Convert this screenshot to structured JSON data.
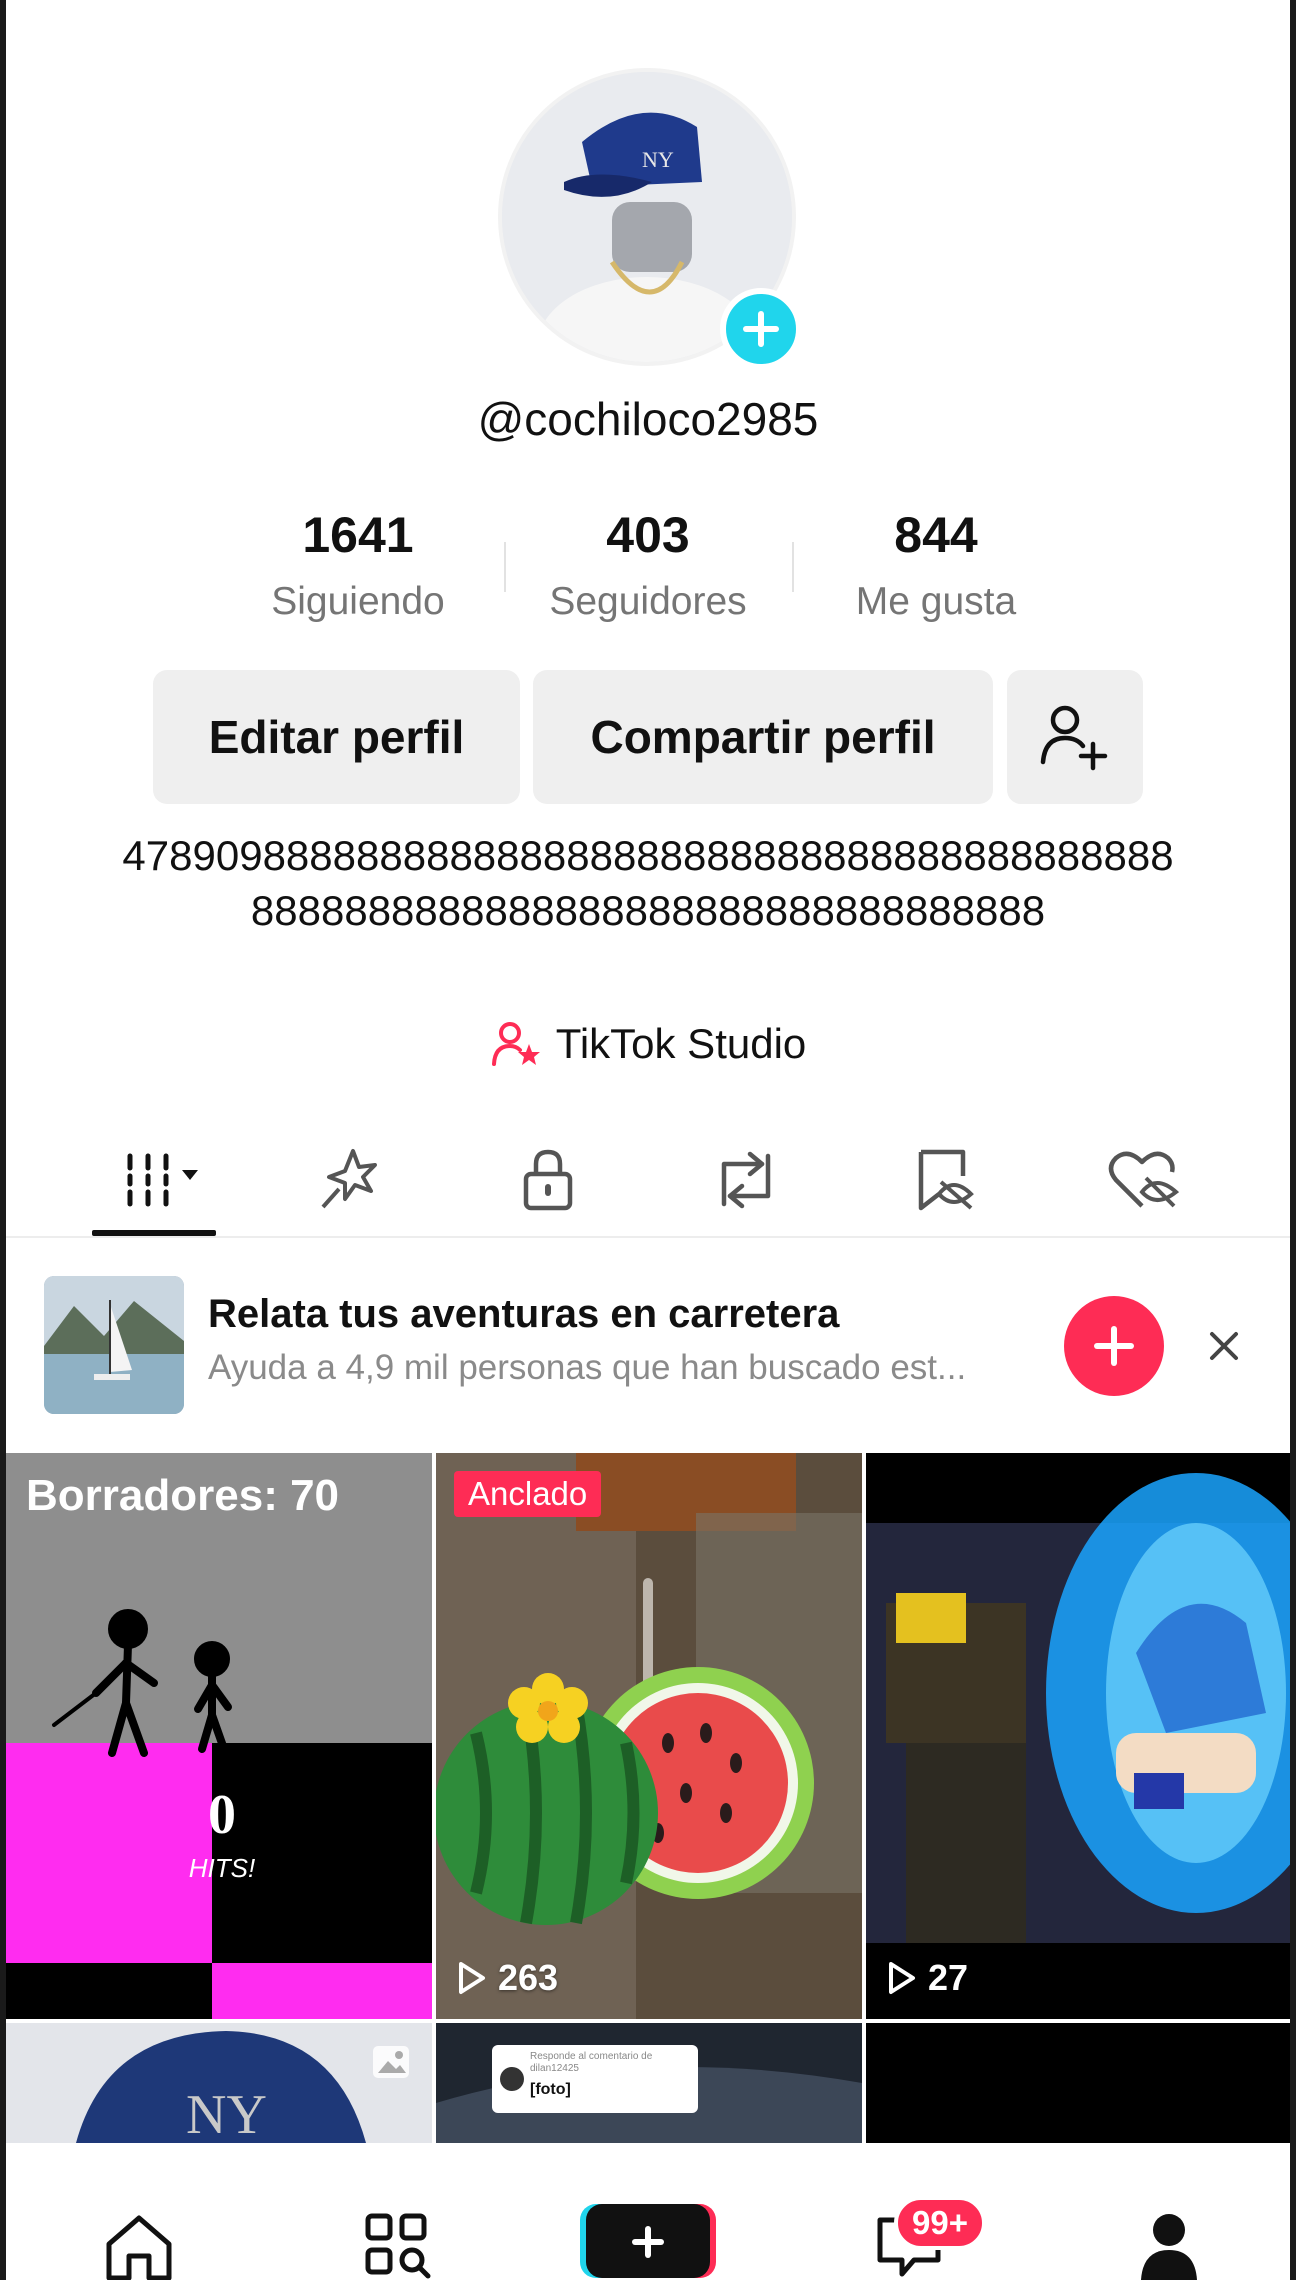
{
  "profile": {
    "username": "@cochiloco2985",
    "stats": [
      {
        "value": "1641",
        "label": "Siguiendo"
      },
      {
        "value": "403",
        "label": "Seguidores"
      },
      {
        "value": "844",
        "label": "Me gusta"
      }
    ],
    "edit_label": "Editar perfil",
    "share_label": "Compartir perfil",
    "bio": "4789098888888888888888888888888888888888888888888888888888888888888888888888888",
    "studio_label": "TikTok Studio"
  },
  "tabs": [
    "videos-tab-icon",
    "reposts-sparkle-icon",
    "private-lock-icon",
    "repost-icon",
    "favorites-icon",
    "liked-heart-icon"
  ],
  "promo": {
    "title": "Relata tus aventuras en carretera",
    "subtitle": "Ayuda a 4,9 mil personas que han buscado est..."
  },
  "grid": {
    "drafts_label": "Borradores: 70",
    "hits_number": "0",
    "hits_label": "HITS!",
    "pinned_label": "Anclado",
    "video2_views": "263",
    "video3_views": "27",
    "reply_title": "Responde al comentario de",
    "reply_user": "dilan12425",
    "reply_text": "[foto]"
  },
  "nav": {
    "badge": "99+"
  },
  "colors": {
    "accent": "#fe2c55",
    "cyan": "#20d5ec"
  }
}
